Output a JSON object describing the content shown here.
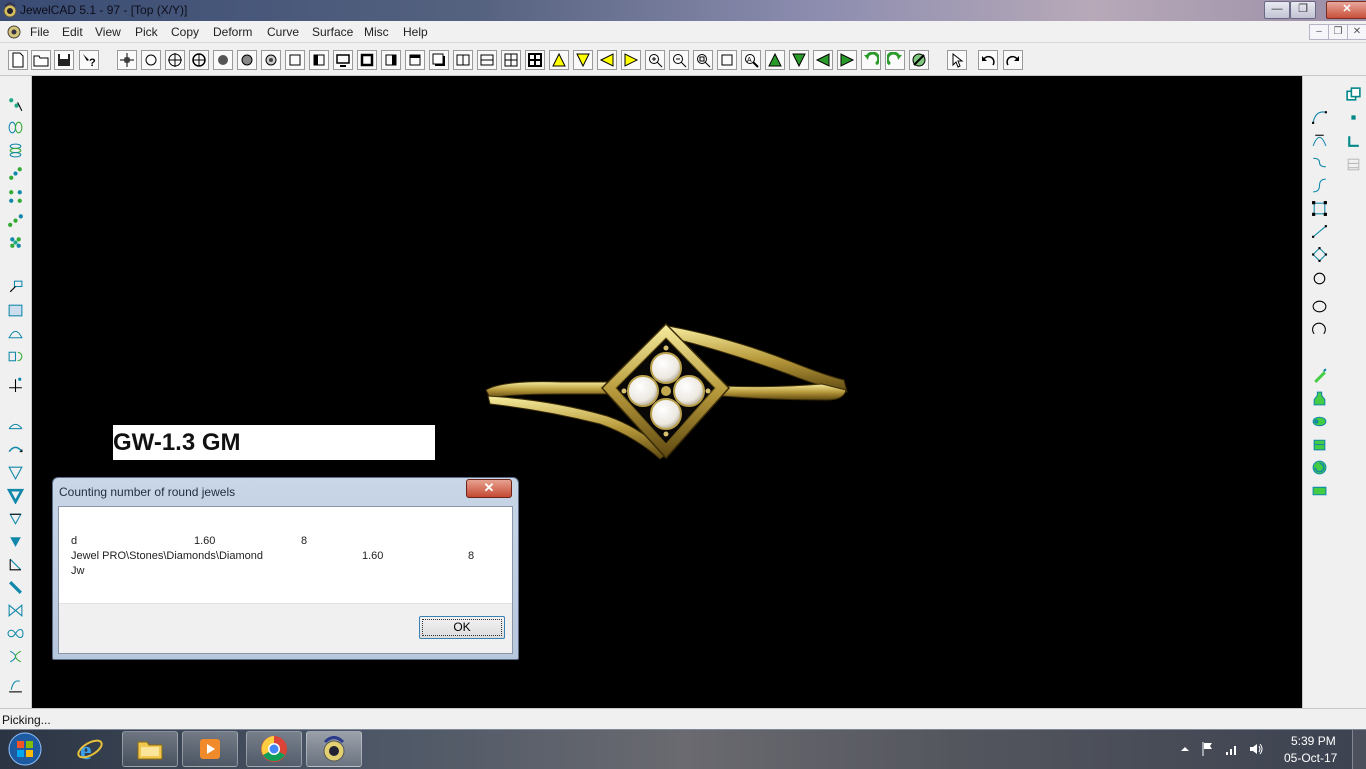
{
  "window": {
    "title": "JewelCAD 5.1 - 97 - [Top (X/Y)]",
    "close_glyph": "✕",
    "maximize_glyph": "❐",
    "minimize_glyph": "—"
  },
  "menu": {
    "items": [
      "File",
      "Edit",
      "View",
      "Pick",
      "Copy",
      "Deform",
      "Curve",
      "Surface",
      "Misc",
      "Help"
    ],
    "mdi_min": "–",
    "mdi_restore": "❐",
    "mdi_close": "✕"
  },
  "toolbar": {
    "icons": [
      "new-file-icon",
      "open-folder-icon",
      "save-icon",
      "context-help-icon",
      "point-pick-icon",
      "circle-icon",
      "target-icon",
      "crosshair-circle-icon",
      "filled-circle-icon",
      "sphere-icon",
      "shaded-sphere-icon",
      "square-icon",
      "half-square-icon",
      "monitor-icon",
      "bold-square-icon",
      "window-right-icon",
      "window-top-icon",
      "window-shadow-icon",
      "split-vertical-icon",
      "split-horizontal-icon",
      "grid-four-icon",
      "grid-bold-icon",
      "triangle-up-icon",
      "triangle-down-icon",
      "triangle-left-icon",
      "triangle-right-icon",
      "zoom-in-icon",
      "zoom-out-icon",
      "zoom-window-icon",
      "zoom-box-icon",
      "zoom-all-icon",
      "arrow-up-green-icon",
      "arrow-down-green-icon",
      "arrow-left-green-icon",
      "arrow-right-green-icon",
      "rotate-left-green-icon",
      "rotate-right-green-icon",
      "render-icon",
      "pointer-icon",
      "undo-icon",
      "redo-icon"
    ]
  },
  "viewport": {
    "weight_label": "GW-1.3 GM",
    "background": "#000000",
    "metal_color": "#c8b45a"
  },
  "dialog": {
    "title": "Counting number of round jewels",
    "close_glyph": "✕",
    "rows": [
      {
        "name": "d",
        "size": "1.60",
        "count": "8"
      },
      {
        "name": "Jewel PRO\\Stones\\Diamonds\\Diamond",
        "size": "1.60",
        "count": "8"
      },
      {
        "name": "Jw",
        "size": "",
        "count": ""
      }
    ],
    "ok_label": "OK"
  },
  "status": {
    "text": "Picking..."
  },
  "taskbar": {
    "items": [
      "start-orb",
      "internet-explorer",
      "file-explorer",
      "media-player",
      "chrome",
      "jewelcad"
    ],
    "clock_time": "5:39 PM",
    "clock_date": "05-Oct-17"
  }
}
